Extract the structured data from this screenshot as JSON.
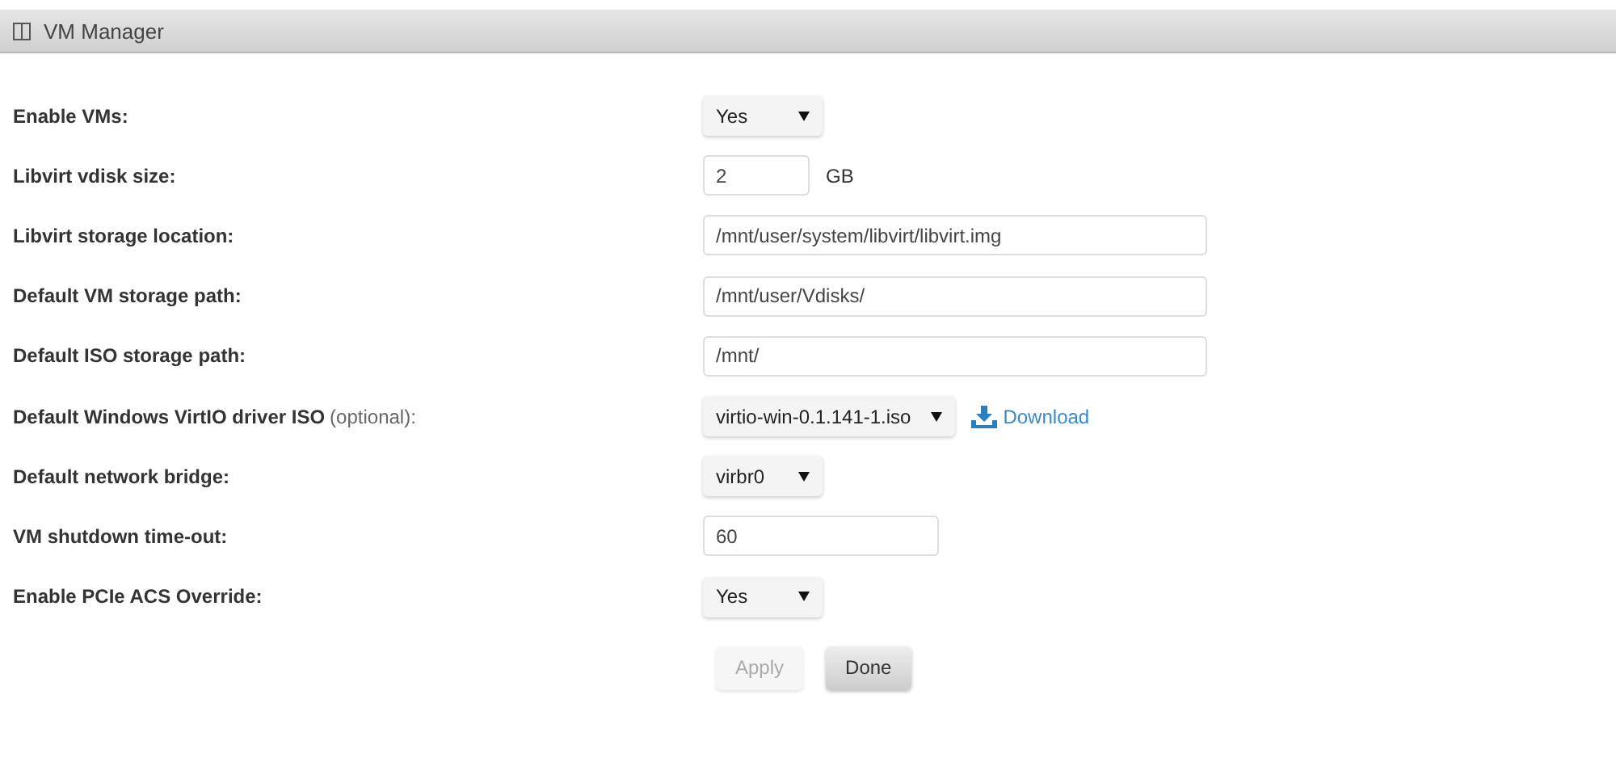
{
  "panel": {
    "title": "VM Manager"
  },
  "settings": [
    {
      "kind": "select",
      "label": "Enable VMs:",
      "value": "Yes"
    },
    {
      "kind": "number",
      "label": "Libvirt vdisk size:",
      "value": "2",
      "unit": "GB"
    },
    {
      "kind": "text",
      "label": "Libvirt storage location:",
      "value": "/mnt/user/system/libvirt/libvirt.img"
    },
    {
      "kind": "text",
      "label": "Default VM storage path:",
      "value": "/mnt/user/Vdisks/"
    },
    {
      "kind": "text",
      "label": "Default ISO storage path:",
      "value": "/mnt/"
    },
    {
      "kind": "select",
      "label": "Default Windows VirtIO driver ISO",
      "note": "(optional):",
      "value": "virtio-win-0.1.141-1.iso",
      "link": "Download"
    },
    {
      "kind": "select",
      "label": "Default network bridge:",
      "value": "virbr0"
    },
    {
      "kind": "medium",
      "label": "VM shutdown time-out:",
      "value": "60"
    },
    {
      "kind": "select",
      "label": "Enable PCIe ACS Override:",
      "value": "Yes"
    }
  ],
  "buttons": [
    {
      "label": "Apply",
      "disabled": true
    },
    {
      "label": "Done",
      "disabled": false
    }
  ]
}
